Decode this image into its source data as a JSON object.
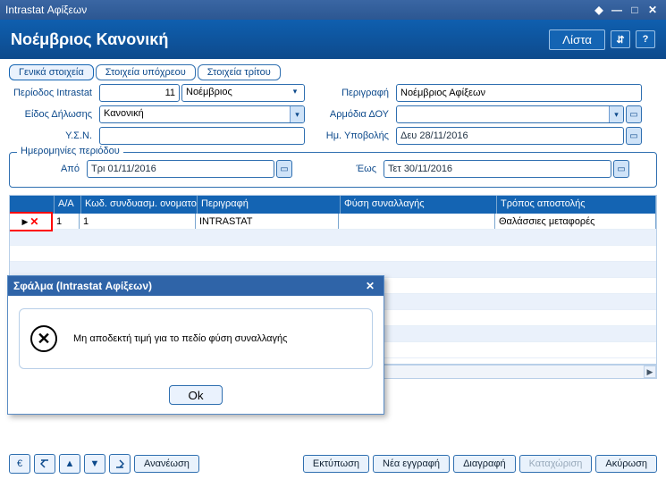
{
  "window": {
    "title": "Intrastat Αφίξεων"
  },
  "titlebar_icons": {
    "diamond": "◆",
    "min": "—",
    "max": "□",
    "close": "✕"
  },
  "header": {
    "title": "Νοέμβριος Κανονική",
    "list_btn": "Λίστα",
    "toggle_icon": "⇵",
    "help_icon": "?"
  },
  "tabs": [
    {
      "label": "Γενικά στοιχεία",
      "active": true
    },
    {
      "label": "Στοιχεία υπόχρεου",
      "active": false
    },
    {
      "label": "Στοιχεία τρίτου",
      "active": false
    }
  ],
  "form": {
    "period_label": "Περίοδος Intrastat",
    "period_num": "11",
    "period_name": "Νοέμβριος",
    "description_label": "Περιγραφή",
    "description": "Νοέμβριος Αφίξεων",
    "declaration_type_label": "Είδος Δήλωσης",
    "declaration_type": "Κανονική",
    "tax_office_label": "Αρμόδια ΔΟΥ",
    "tax_office": "",
    "ysn_label": "Υ.Σ.Ν.",
    "ysn": "",
    "submit_date_label": "Ημ. Υποβολής",
    "submit_date": "Δευ 28/11/2016"
  },
  "period_group": {
    "title": "Ημερομηνίες περιόδου",
    "from_label": "Από",
    "from_date": "Τρι 01/11/2016",
    "to_label": "Έως",
    "to_date": "Τετ 30/11/2016"
  },
  "grid": {
    "columns": {
      "aa": "Α/Α",
      "code": "Κωδ. συνδυασμ. ονοματολ.",
      "desc": "Περιγραφή",
      "nat": "Φύση συναλλαγής",
      "ship": "Τρόπος αποστολής"
    },
    "rows": [
      {
        "aa": "1",
        "code": "1",
        "desc": "INTRASTAT",
        "nat": "",
        "ship": "Θαλάσσιες μεταφορές"
      }
    ]
  },
  "dialog": {
    "title": "Σφάλμα   (Intrastat Αφίξεων)",
    "message": "Μη αποδεκτή τιμή για το πεδίο φύση συναλλαγής",
    "ok": "Ok"
  },
  "footer": {
    "euro": "€",
    "refresh": "Ανανέωση",
    "print": "Εκτύπωση",
    "new_rec": "Νέα εγγραφή",
    "delete": "Διαγραφή",
    "save": "Καταχώριση",
    "cancel": "Ακύρωση"
  },
  "icons": {
    "dropdown": "▾",
    "calendar": "▭",
    "first": "▲̲",
    "prev": "▲",
    "next": "▼",
    "last": "▼̲",
    "scroll_left": "◀",
    "scroll_right": "▶"
  }
}
